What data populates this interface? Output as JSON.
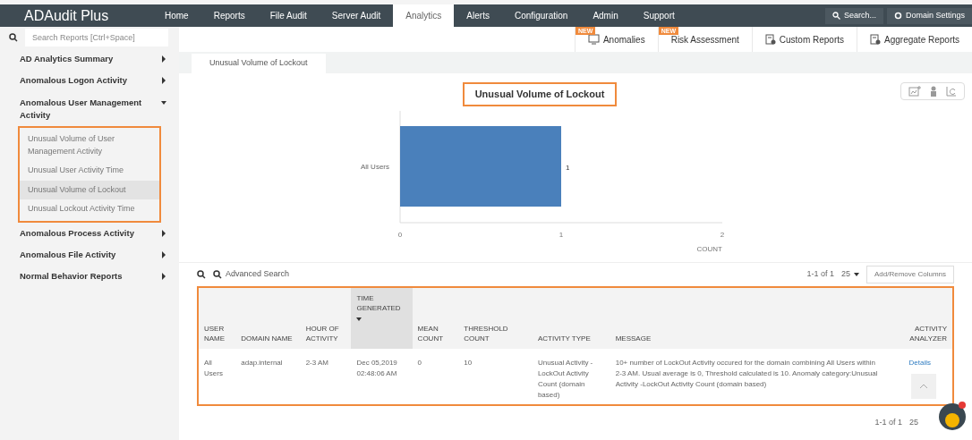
{
  "app_title": "ADAudit Plus",
  "nav_tabs": [
    {
      "label": "Home",
      "selected": false
    },
    {
      "label": "Reports",
      "selected": false
    },
    {
      "label": "File Audit",
      "selected": false
    },
    {
      "label": "Server Audit",
      "selected": false
    },
    {
      "label": "Analytics",
      "selected": true
    },
    {
      "label": "Alerts",
      "selected": false
    },
    {
      "label": "Configuration",
      "selected": false
    },
    {
      "label": "Admin",
      "selected": false
    },
    {
      "label": "Support",
      "selected": false
    }
  ],
  "top_search": "Search...",
  "domain_settings": "Domain Settings",
  "report_search": {
    "placeholder": "Search Reports [Ctrl+Space]"
  },
  "sub_tabs": [
    {
      "label": "Anomalies",
      "badge": "NEW"
    },
    {
      "label": "Risk Assessment",
      "badge": "NEW"
    },
    {
      "label": "Custom Reports"
    },
    {
      "label": "Aggregate Reports"
    }
  ],
  "sidebar": {
    "items": [
      {
        "label": "AD Analytics Summary",
        "expanded": false
      },
      {
        "label": "Anomalous Logon Activity",
        "expanded": false
      },
      {
        "label": "Anomalous User Management Activity",
        "expanded": true,
        "children": [
          {
            "label": "Unusual Volume of User Management Activity",
            "selected": false
          },
          {
            "label": "Unusual User Activity Time",
            "selected": false
          },
          {
            "label": "Unusual Volume of Lockout",
            "selected": true
          },
          {
            "label": "Unusual Lockout Activity Time",
            "selected": false
          }
        ]
      },
      {
        "label": "Anomalous Process Activity",
        "expanded": false
      },
      {
        "label": "Anomalous File Activity",
        "expanded": false
      },
      {
        "label": "Normal Behavior Reports",
        "expanded": false
      }
    ]
  },
  "report_tab": "Unusual Volume of Lockout",
  "chart": {
    "chart_data": {
      "type": "bar",
      "orientation": "horizontal",
      "title": "Unusual Volume of Lockout",
      "xlabel": "COUNT",
      "categories": [
        "All Users"
      ],
      "values": [
        1
      ],
      "xlim": [
        0,
        2
      ],
      "xticks": [
        0,
        1,
        2
      ],
      "data_labels": true
    }
  },
  "toolbar": {
    "advanced_search": "Advanced Search",
    "range": "1-1 of 1",
    "page_size": "25",
    "columns_button": "Add/Remove Columns"
  },
  "table": {
    "columns": [
      {
        "label": "USER NAME",
        "sorted": false
      },
      {
        "label": "DOMAIN NAME",
        "sorted": false
      },
      {
        "label": "HOUR OF ACTIVITY",
        "sorted": false
      },
      {
        "label": "TIME GENERATED",
        "sorted": true
      },
      {
        "label": "MEAN COUNT",
        "sorted": false
      },
      {
        "label": "THRESHOLD COUNT",
        "sorted": false
      },
      {
        "label": "ACTIVITY TYPE",
        "sorted": false
      },
      {
        "label": "MESSAGE",
        "sorted": false
      },
      {
        "label": "ACTIVITY ANALYZER",
        "sorted": false
      }
    ],
    "rows": [
      {
        "cells": [
          "All Users",
          "adap.internal",
          "2-3 AM",
          "Dec 05,2019 02:48:06 AM",
          "0",
          "10",
          "Unusual Activity - LockOut Activity Count (domain based)",
          "10+ number of LockOut Activity occured for the domain combining All Users within 2-3 AM. Usual average is 0, Threshold calculated is 10. Anomaly category:Unusual Activity -LockOut Activity Count (domain based)",
          "Details"
        ]
      }
    ]
  },
  "footer": {
    "range": "1-1 of 1",
    "page_size": "25"
  }
}
